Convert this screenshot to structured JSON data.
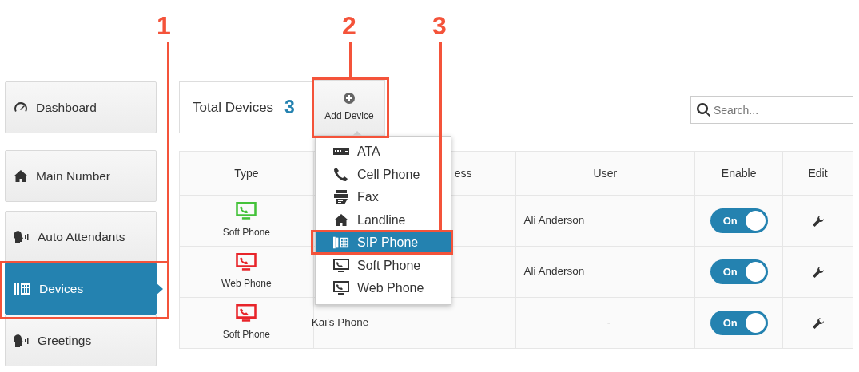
{
  "sidebar": {
    "items": [
      {
        "label": "Dashboard",
        "kind": "gauge",
        "selected": false
      },
      {
        "label": "Main Number",
        "kind": "house",
        "selected": false
      },
      {
        "label": "Auto Attendants",
        "kind": "speaker",
        "selected": false
      },
      {
        "label": "Devices",
        "kind": "sip",
        "selected": true
      },
      {
        "label": "Greetings",
        "kind": "speaker",
        "selected": false
      }
    ]
  },
  "header": {
    "title": "Total Devices",
    "count": "3",
    "add_button": "Add Device",
    "search": {
      "placeholder": "Search..."
    }
  },
  "add_menu": {
    "items": [
      {
        "label": "ATA",
        "kind": "ata",
        "selected": false
      },
      {
        "label": "Cell Phone",
        "kind": "cell",
        "selected": false
      },
      {
        "label": "Fax",
        "kind": "fax",
        "selected": false
      },
      {
        "label": "Landline",
        "kind": "house",
        "selected": false
      },
      {
        "label": "SIP Phone",
        "kind": "sip",
        "selected": true
      },
      {
        "label": "Soft Phone",
        "kind": "monitor",
        "selected": false
      },
      {
        "label": "Web Phone",
        "kind": "monitor",
        "selected": false
      }
    ]
  },
  "table": {
    "columns": [
      "Type",
      "ess",
      "User",
      "Enable",
      "Edit"
    ],
    "rows": [
      {
        "type": "Soft Phone",
        "color": "#44c23a",
        "user": "Ali Anderson",
        "toggle": "On",
        "on": true
      },
      {
        "type": "Web Phone",
        "color": "#e8242a",
        "user": "Ali Anderson",
        "toggle": "On",
        "on": true
      },
      {
        "type": "Soft Phone",
        "color": "#e8242a",
        "name": "Kai's Phone",
        "user": "-",
        "toggle": "On",
        "on": true
      }
    ]
  },
  "callouts": [
    {
      "label": "1"
    },
    {
      "label": "2"
    },
    {
      "label": "3"
    }
  ]
}
